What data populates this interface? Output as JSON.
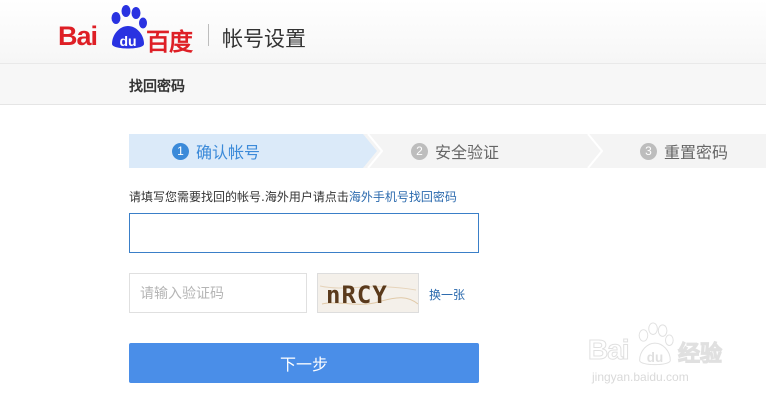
{
  "header": {
    "logo_latin": "Bai",
    "logo_du": "du",
    "logo_cn": "百度",
    "title": "帐号设置"
  },
  "subbar": {
    "title": "找回密码"
  },
  "steps": [
    {
      "num": "1",
      "label": "确认帐号",
      "active": true
    },
    {
      "num": "2",
      "label": "安全验证",
      "active": false
    },
    {
      "num": "3",
      "label": "重置密码",
      "active": false
    }
  ],
  "form": {
    "hint_text": "请填写您需要找回的帐号.海外用户请点击",
    "hint_link": "海外手机号找回密码",
    "account_value": "",
    "captcha_placeholder": "请输入验证码",
    "captcha_text": "nRCY",
    "captcha_refresh": "换一张",
    "next_label": "下一步"
  },
  "watermark": {
    "latin": "Bai",
    "du": "du",
    "cn": "经验",
    "url": "jingyan.baidu.com"
  },
  "colors": {
    "brand_red": "#de1f26",
    "brand_blue": "#2932e1",
    "accent_blue": "#3b8ad9",
    "button_blue": "#4a8ee8",
    "link_blue": "#2b6aae"
  }
}
